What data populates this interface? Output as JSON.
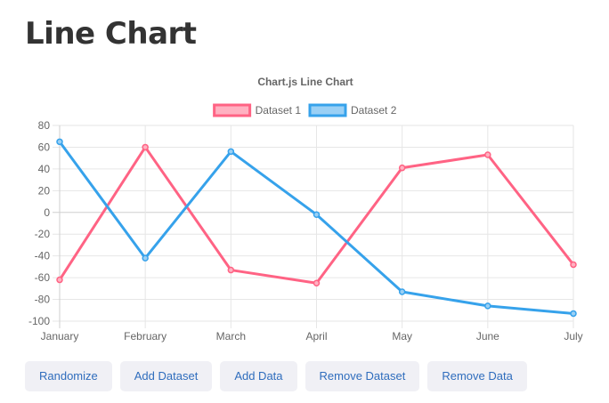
{
  "page": {
    "title": "Line Chart"
  },
  "chart_data": {
    "type": "line",
    "title": "Chart.js Line Chart",
    "categories": [
      "January",
      "February",
      "March",
      "April",
      "May",
      "June",
      "July"
    ],
    "ylim": [
      -100,
      80
    ],
    "yticks": [
      80,
      60,
      40,
      20,
      0,
      -20,
      -40,
      -60,
      -80,
      -100
    ],
    "grid": true,
    "legend_position": "top",
    "series": [
      {
        "name": "Dataset 1",
        "color": "#ff6384",
        "fill": "#ffb1c1",
        "values": [
          -62,
          60,
          -53,
          -65,
          41,
          53,
          -48
        ]
      },
      {
        "name": "Dataset 2",
        "color": "#36a2eb",
        "fill": "#9ad0f5",
        "values": [
          65,
          -42,
          56,
          -2,
          -73,
          -86,
          -93
        ]
      }
    ]
  },
  "buttons": {
    "randomize": "Randomize",
    "add_dataset": "Add Dataset",
    "add_data": "Add Data",
    "remove_dataset": "Remove Dataset",
    "remove_data": "Remove Data"
  }
}
